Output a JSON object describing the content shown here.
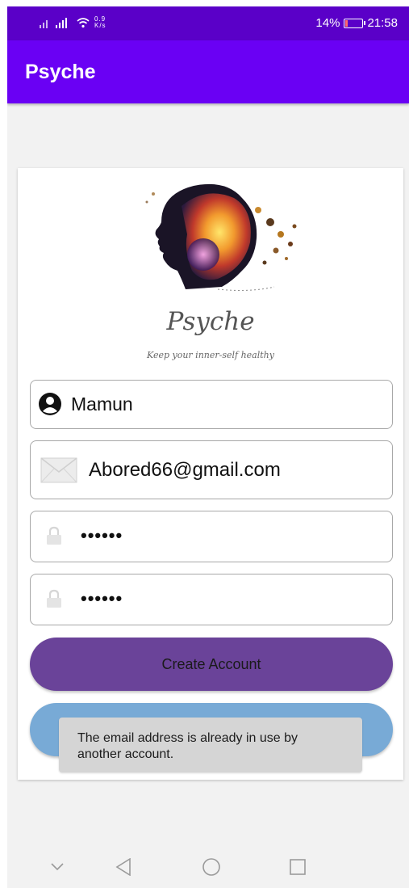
{
  "status_bar": {
    "network_speed": "0.9\nK/s",
    "battery_percent": "14%",
    "battery_level": 0.14,
    "time": "21:58"
  },
  "app_bar": {
    "title": "Psyche"
  },
  "logo": {
    "brand_name": "Psyche",
    "tagline": "Keep your inner-self healthy"
  },
  "form": {
    "name_value": "Mamun",
    "email_value": "Abored66@gmail.com",
    "password_value": "••••••",
    "confirm_password_value": "••••••"
  },
  "buttons": {
    "create_account": "Create Account",
    "secondary": ""
  },
  "toast": {
    "message": "The email address is already in use by another account."
  },
  "colors": {
    "status_bar": "#5a00c8",
    "app_bar": "#6a00f4",
    "create_button": "#6a4399",
    "secondary_button": "#78aad6",
    "toast": "#d5d5d5"
  },
  "nav": {
    "icons": [
      "chevron-down-icon",
      "back-icon",
      "home-icon",
      "recents-icon"
    ]
  }
}
